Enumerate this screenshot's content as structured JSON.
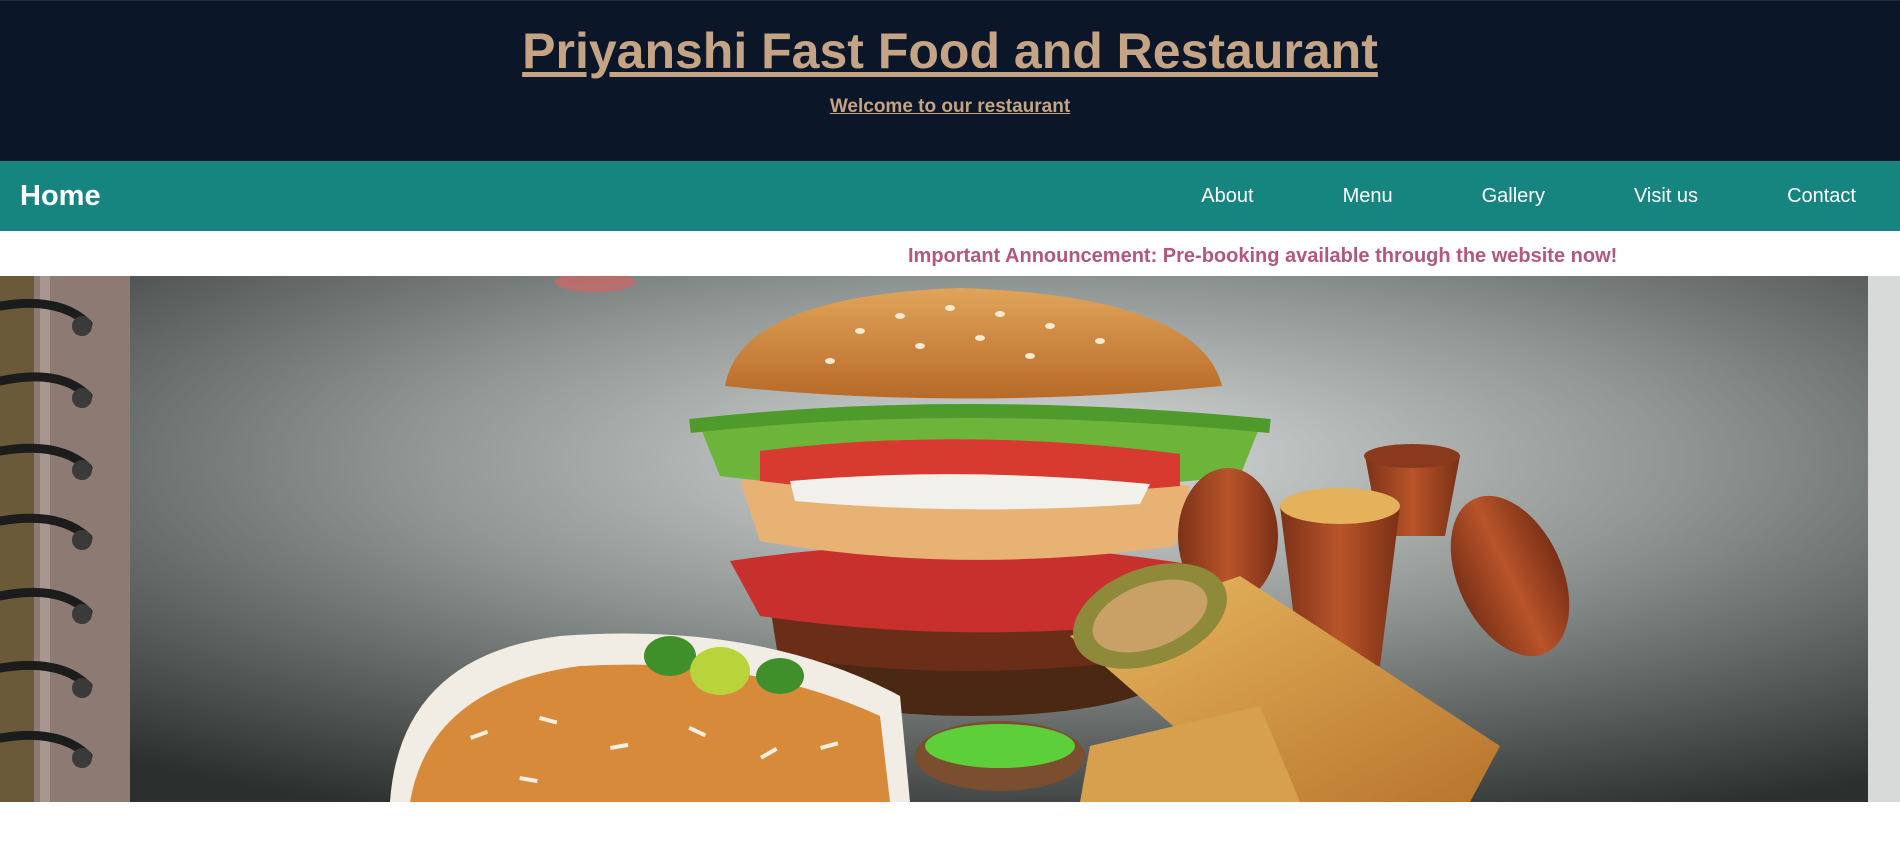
{
  "header": {
    "title": "Priyanshi Fast Food and Restaurant",
    "subtitle": "Welcome to our restaurant"
  },
  "nav": {
    "home_label": "Home",
    "items": [
      {
        "label": "About"
      },
      {
        "label": "Menu"
      },
      {
        "label": "Gallery"
      },
      {
        "label": "Visit us"
      },
      {
        "label": "Contact"
      }
    ]
  },
  "announcement": {
    "text": "Important Announcement: Pre-booking available through the website now!"
  },
  "hero": {
    "image_alt": "Burger, biryani, wraps and kulhad chai on a menu card"
  },
  "colors": {
    "header_bg": "#0b1728",
    "title_text": "#c4a484",
    "nav_bg": "#168580",
    "nav_text": "#ffffff",
    "announcement_text": "#b3577e"
  }
}
